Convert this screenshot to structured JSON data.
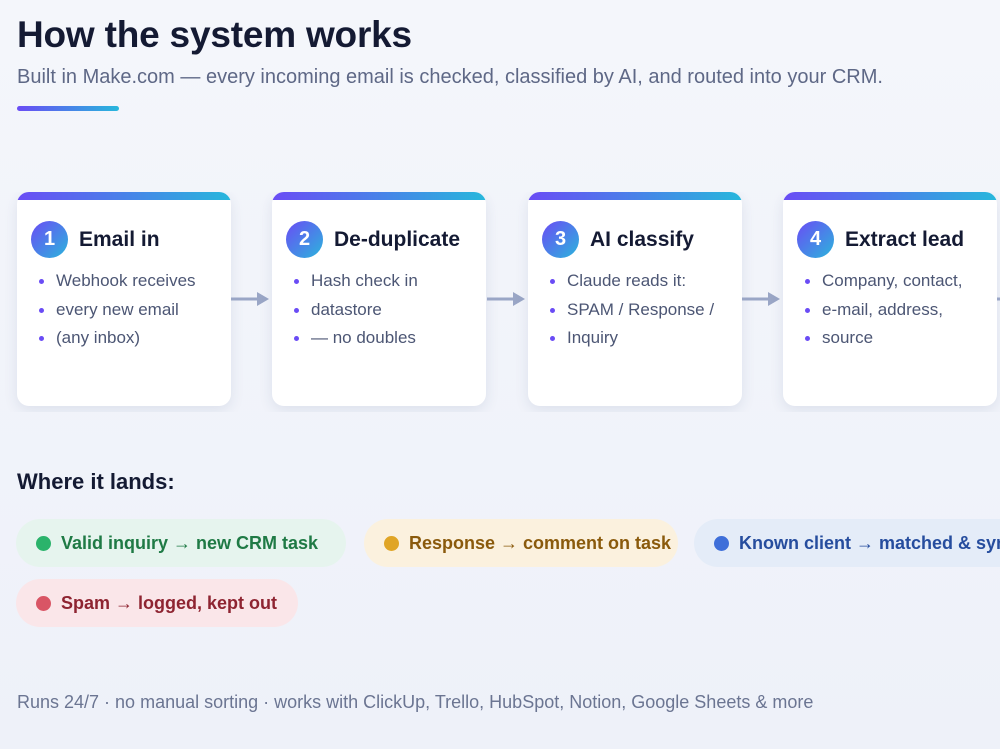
{
  "header": {
    "title": "How the system works",
    "subtitle": "Built in Make.com — every incoming email is checked, classified by AI, and routed into your CRM."
  },
  "steps": [
    {
      "number": "1",
      "title": "Email in",
      "bullets": [
        "Webhook receives",
        "every new email",
        "(any inbox)"
      ]
    },
    {
      "number": "2",
      "title": "De-duplicate",
      "bullets": [
        "Hash check in",
        "datastore",
        "— no doubles"
      ]
    },
    {
      "number": "3",
      "title": "AI classify",
      "bullets": [
        "Claude reads it:",
        "SPAM / Response /",
        "Inquiry"
      ]
    },
    {
      "number": "4",
      "title": "Extract lead",
      "bullets": [
        "Company, contact,",
        "e-mail, address,",
        "source"
      ]
    }
  ],
  "lands": {
    "title": "Where it lands:",
    "outcomes": [
      {
        "label": "Valid inquiry → new CRM task",
        "dot_color": "#2bb36b",
        "text_color": "#1f7a45",
        "bg_color": "#e6f4ee"
      },
      {
        "label": "Response → comment on task",
        "dot_color": "#e0a526",
        "text_color": "#8a5a0c",
        "bg_color": "#fbf1de"
      },
      {
        "label": "Known client → matched & synced",
        "dot_color": "#3f6fd9",
        "text_color": "#264d9e",
        "bg_color": "#e4ecf8"
      },
      {
        "label": "Spam → logged, kept out",
        "dot_color": "#d95565",
        "text_color": "#8e2431",
        "bg_color": "#fae6e9"
      }
    ]
  },
  "footer": {
    "text": "Runs 24/7 · no manual sorting · works with ClickUp, Trello, HubSpot, Notion, Google Sheets & more"
  },
  "colors": {
    "accent_start": "#6a4cf5",
    "accent_end": "#27b7dc",
    "arrow": "#9aa6c6"
  }
}
